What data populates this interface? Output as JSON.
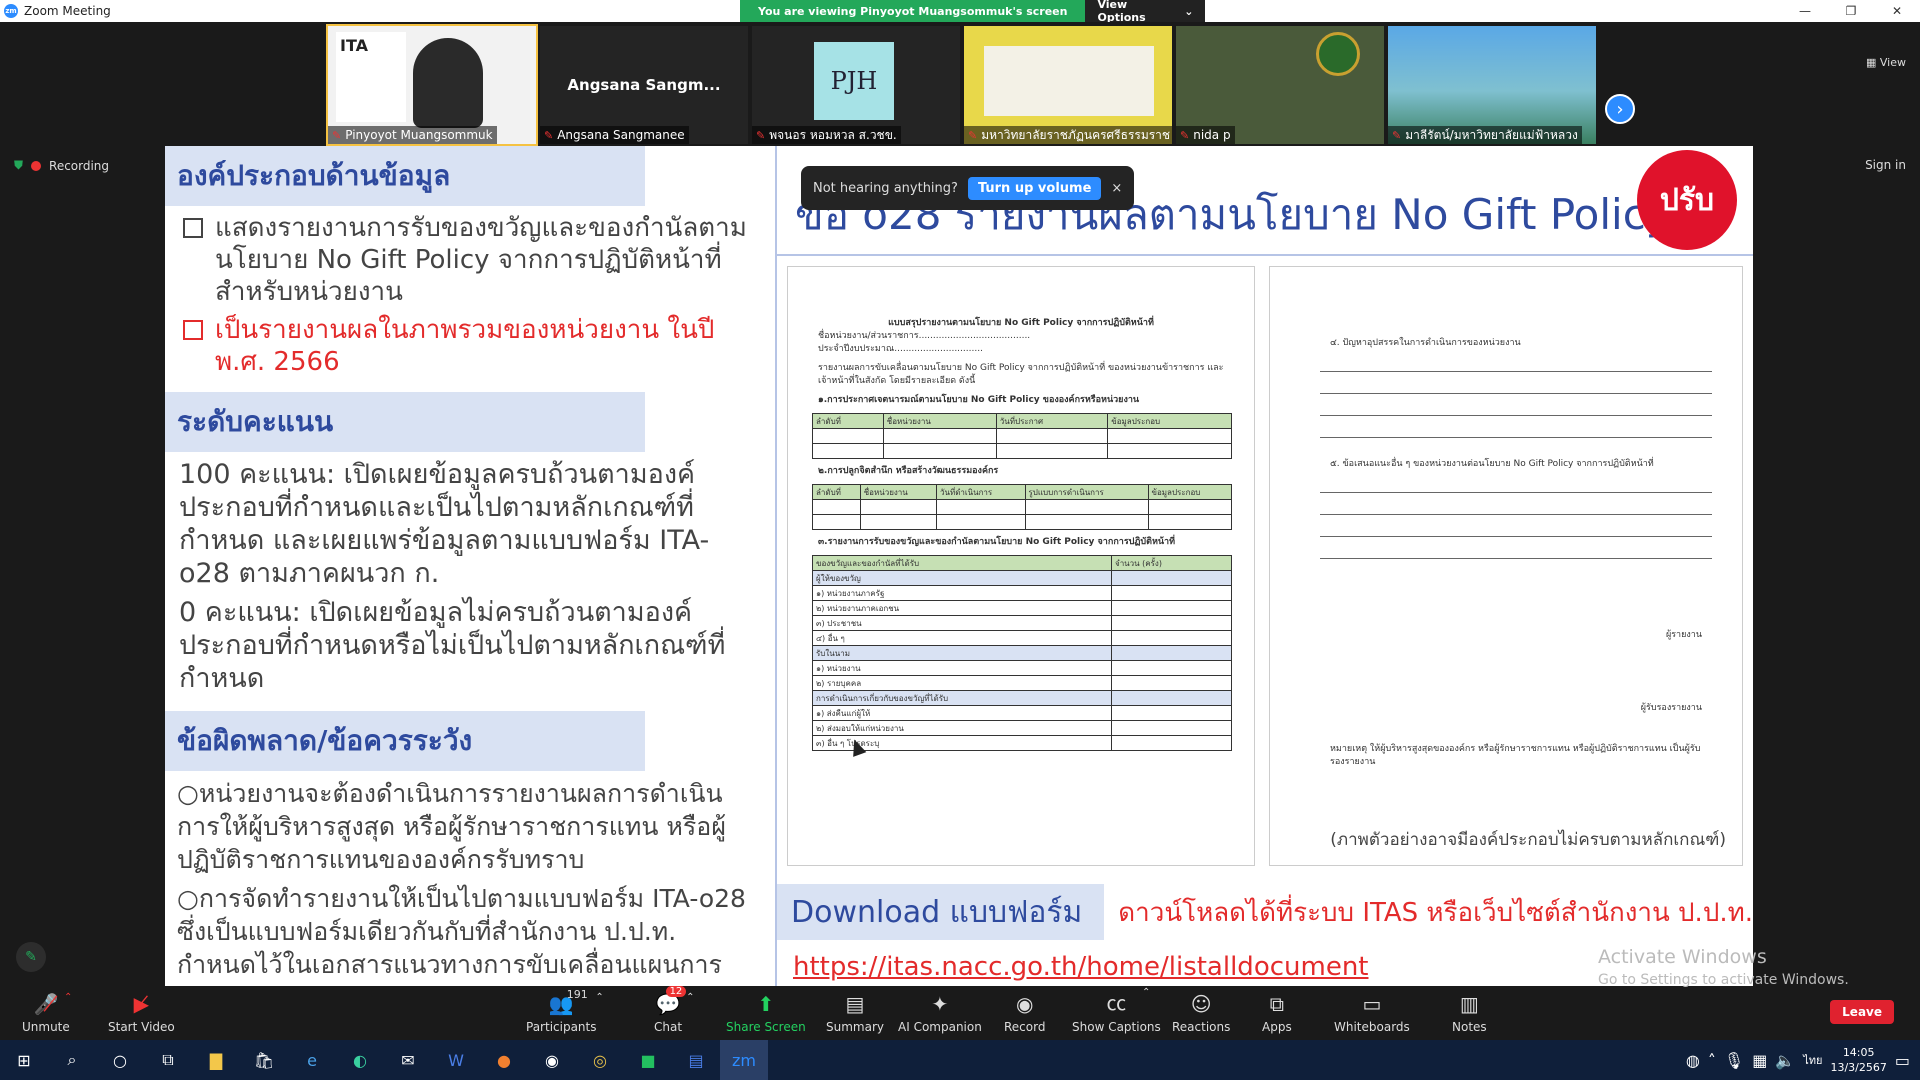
{
  "window": {
    "title": "Zoom Meeting",
    "logo": "zm"
  },
  "banner": {
    "message": "You are viewing Pinyoyot Muangsommuk's screen",
    "view_options": "View Options"
  },
  "participants_strip": [
    {
      "name": "Pinyoyot Muangsommuk",
      "active": true
    },
    {
      "name": "Angsana Sangmanee",
      "display": "Angsana Sangm..."
    },
    {
      "name": "พจนอร หอมหวล ส.วชข.",
      "avatar_text": "PJH"
    },
    {
      "name": "มหาวิทยาลัยราชภัฏนครศรีธรรมราช"
    },
    {
      "name": "nida p"
    },
    {
      "name": "มาลีรัตน์/มหาวิทยาลัยแม่ฟ้าหลวง"
    }
  ],
  "view_label": "View",
  "recording": {
    "label": "Recording"
  },
  "sign_in": "Sign in",
  "toast": {
    "text": "Not hearing anything?",
    "button": "Turn up volume",
    "close": "×"
  },
  "slide": {
    "left": {
      "section1_title": "องค์ประกอบด้านข้อมูล",
      "item1": "แสดงรายงานการรับของขวัญและของกำนัลตามนโยบาย No Gift Policy จากการปฏิบัติหน้าที่ สำหรับหน่วยงาน",
      "item2": "เป็นรายงานผลในภาพรวมของหน่วยงาน ในปี พ.ศ. 2566",
      "section2_title": "ระดับคะแนน",
      "score100": "100 คะแนน: เปิดเผยข้อมูลครบถ้วนตามองค์ประกอบที่กำหนดและเป็นไปตามหลักเกณฑ์ที่กำหนด และเผยแพร่ข้อมูลตามแบบฟอร์ม ITA-o28 ตามภาคผนวก ก.",
      "score0": "0 คะแนน: เปิดเผยข้อมูลไม่ครบถ้วนตามองค์ประกอบที่กำหนดหรือไม่เป็นไปตามหลักเกณฑ์ที่กำหนด",
      "section3_title": "ข้อผิดพลาด/ข้อควรระวัง",
      "caution1": "หน่วยงานจะต้องดำเนินการรายงานผลการดำเนินการให้ผู้บริหารสูงสุด หรือผู้รักษาราชการแทน หรือผู้ปฏิบัติราชการแทนขององค์กรรับทราบ",
      "caution2": "การจัดทำรายงานให้เป็นไปตามแบบฟอร์ม ITA-o28 ซึ่งเป็นแบบฟอร์มเดียวกันกับที่สำนักงาน ป.ป.ท. กำหนดไว้ในเอกสารแนวทางการขับเคลื่อนแผนการ"
    },
    "right": {
      "title": "ข้อ o28 รายงานผลตามนโยบาย No Gift Policy",
      "badge": "ปรับ",
      "doc1": {
        "heading": "แบบสรุปรายงานตามนโยบาย No Gift Policy จากการปฏิบัติหน้าที่",
        "agency_line": "ชื่อหน่วยงาน/ส่วนราชการ.......................................",
        "year_line": "ประจำปีงบประมาณ...............................",
        "intro": "รายงานผลการขับเคลื่อนตามนโยบาย No Gift Policy จากการปฏิบัติหน้าที่ ของหน่วยงานข้าราชการ และเจ้าหน้าที่ในสังกัด โดยมีรายละเอียด ดังนี้",
        "sec1": "๑.การประกาศเจตนารมณ์ตามนโยบาย No Gift Policy ขององค์กรหรือหน่วยงาน",
        "table1_headers": [
          "ลำดับที่",
          "ชื่อหน่วยงาน",
          "วันที่ประกาศ",
          "ข้อมูลประกอบ"
        ],
        "sec2": "๒.การปลูกจิตสำนึก หรือสร้างวัฒนธรรมองค์กร",
        "table2_headers": [
          "ลำดับที่",
          "ชื่อหน่วยงาน",
          "วันที่ดำเนินการ",
          "รูปแบบการดำเนินการ",
          "ข้อมูลประกอบ"
        ],
        "sec3": "๓.รายงานการรับของขวัญและของกำนัลตามนโยบาย No Gift Policy จากการปฏิบัติหน้าที่",
        "table3_headers": [
          "ของขวัญและของกำนัลที่ได้รับ",
          "จำนวน (ครั้ง)"
        ],
        "table3_rows": [
          {
            "label": "ผู้ให้ของขวัญ",
            "group": true
          },
          {
            "label": "๑) หน่วยงานภาครัฐ"
          },
          {
            "label": "๒) หน่วยงานภาคเอกชน"
          },
          {
            "label": "๓) ประชาชน"
          },
          {
            "label": "๔) อื่น ๆ"
          },
          {
            "label": "รับในนาม",
            "group": true
          },
          {
            "label": "๑) หน่วยงาน"
          },
          {
            "label": "๒) รายบุคคล"
          },
          {
            "label": "การดำเนินการเกี่ยวกับของขวัญที่ได้รับ",
            "group": true
          },
          {
            "label": "๑) ส่งคืนแก่ผู้ให้"
          },
          {
            "label": "๒) ส่งมอบให้แก่หน่วยงาน"
          },
          {
            "label": "๓) อื่น ๆ โปรดระบุ"
          }
        ]
      },
      "doc2": {
        "item4": "๔. ปัญหาอุปสรรคในการดำเนินการของหน่วยงาน",
        "item5": "๕. ข้อเสนอแนะอื่น ๆ ของหน่วยงานต่อนโยบาย No Gift Policy จากการปฏิบัติหน้าที่",
        "sign1": "ผู้รายงาน",
        "sign2": "ผู้รับรองรายงาน",
        "note": "หมายเหตุ ให้ผู้บริหารสูงสุดขององค์กร หรือผู้รักษาราชการแทน หรือผู้ปฏิบัติราชการแทน เป็นผู้รับรองรายงาน",
        "caption": "(ภาพตัวอย่างอาจมีองค์ประกอบไม่ครบตามหลักเกณฑ์)"
      },
      "download_label": "Download แบบฟอร์ม",
      "download_text": "ดาวน์โหลดได้ที่ระบบ ITAS หรือเว็บไซต์สำนักงาน ป.ป.ท.",
      "url": "https://itas.nacc.go.th/home/listalldocument"
    }
  },
  "watermark": {
    "line1": "Activate Windows",
    "line2": "Go to Settings to activate Windows."
  },
  "toolbar": [
    {
      "label": "Unmute",
      "icon": "mic-muted-icon"
    },
    {
      "label": "Start Video",
      "icon": "video-off-icon"
    },
    {
      "label": "Participants",
      "icon": "participants-icon",
      "count": "191"
    },
    {
      "label": "Chat",
      "icon": "chat-icon",
      "badge": "12"
    },
    {
      "label": "Share Screen",
      "icon": "share-screen-icon"
    },
    {
      "label": "Summary",
      "icon": "summary-icon"
    },
    {
      "label": "AI Companion",
      "icon": "ai-companion-icon"
    },
    {
      "label": "Record",
      "icon": "record-icon"
    },
    {
      "label": "Show Captions",
      "icon": "captions-icon"
    },
    {
      "label": "Reactions",
      "icon": "reactions-icon"
    },
    {
      "label": "Apps",
      "icon": "apps-icon"
    },
    {
      "label": "Whiteboards",
      "icon": "whiteboard-icon"
    },
    {
      "label": "Notes",
      "icon": "notes-icon"
    }
  ],
  "leave": "Leave",
  "taskbar": {
    "time": "14:05",
    "date": "13/3/2567",
    "lang": "ไทย",
    "zoom_label": "zm"
  }
}
